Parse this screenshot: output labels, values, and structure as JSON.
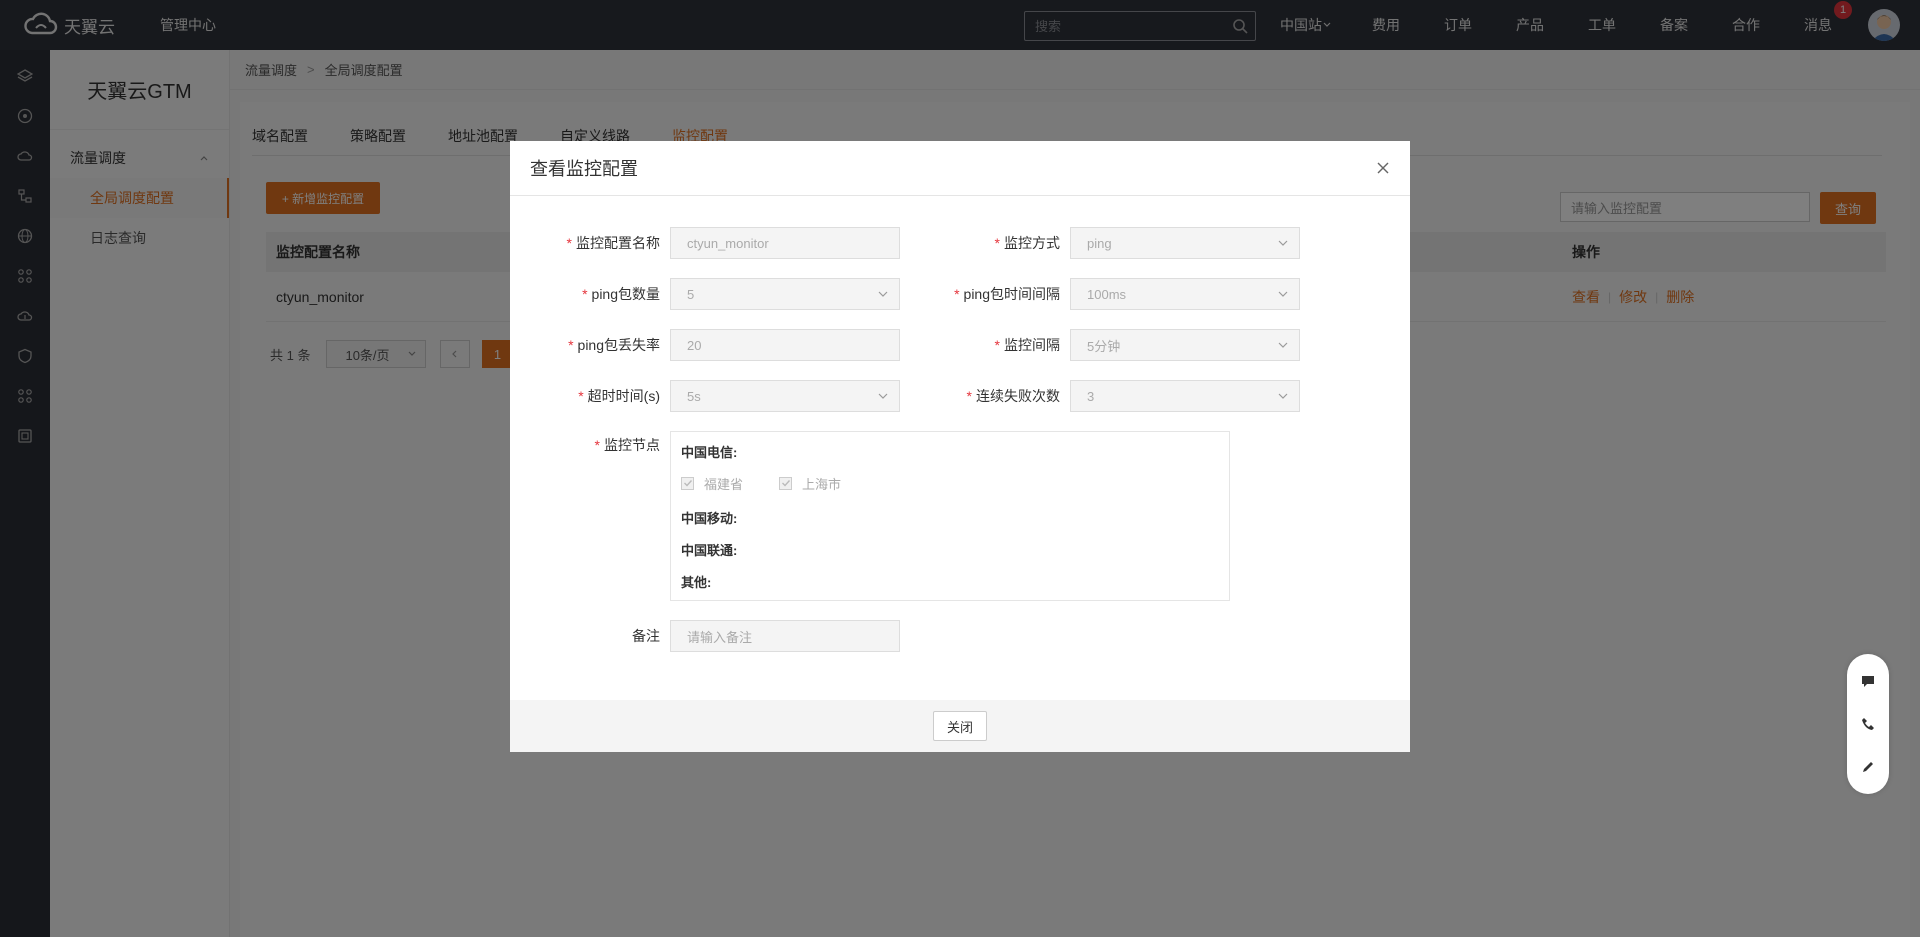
{
  "topbar": {
    "brand": "天翼云",
    "mgmt": "管理中心",
    "search_placeholder": "搜索",
    "nav": [
      "中国站",
      "费用",
      "订单",
      "产品",
      "工单",
      "备案",
      "合作",
      "消息"
    ],
    "message_badge": "1"
  },
  "sidebar": {
    "title": "天翼云GTM",
    "group": "流量调度",
    "items": [
      "全局调度配置",
      "日志查询"
    ]
  },
  "breadcrumb": {
    "parent": "流量调度",
    "current": "全局调度配置"
  },
  "tabs": [
    "域名配置",
    "策略配置",
    "地址池配置",
    "自定义线路",
    "监控配置"
  ],
  "list": {
    "add_button": "+ 新增监控配置",
    "search_placeholder": "请输入监控配置",
    "query_button": "查询",
    "col_name": "监控配置名称",
    "col_ops": "操作",
    "row_name": "ctyun_monitor",
    "op_view": "查看",
    "op_edit": "修改",
    "op_delete": "删除"
  },
  "pager": {
    "total": "共 1 条",
    "page_size": "10条/页",
    "page": "1"
  },
  "modal": {
    "title": "查看监控配置",
    "fields": {
      "name_label": "监控配置名称",
      "name_value": "ctyun_monitor",
      "method_label": "监控方式",
      "method_value": "ping",
      "count_label": "ping包数量",
      "count_value": "5",
      "interval_ping_label": "ping包时间间隔",
      "interval_ping_value": "100ms",
      "loss_label": "ping包丢失率",
      "loss_value": "20",
      "monitor_interval_label": "监控间隔",
      "monitor_interval_value": "5分钟",
      "timeout_label": "超时时间(s)",
      "timeout_value": "5s",
      "fail_label": "连续失败次数",
      "fail_value": "3",
      "nodes_label": "监控节点",
      "remark_label": "备注",
      "remark_placeholder": "请输入备注"
    },
    "nodes": {
      "telecom": "中国电信:",
      "telecom_items": [
        "福建省",
        "上海市"
      ],
      "mobile": "中国移动:",
      "unicom": "中国联通:",
      "other": "其他:"
    },
    "close_button": "关闭"
  },
  "colors": {
    "accent": "#e07020",
    "topbar": "#2f323a",
    "required": "#e5353d"
  }
}
